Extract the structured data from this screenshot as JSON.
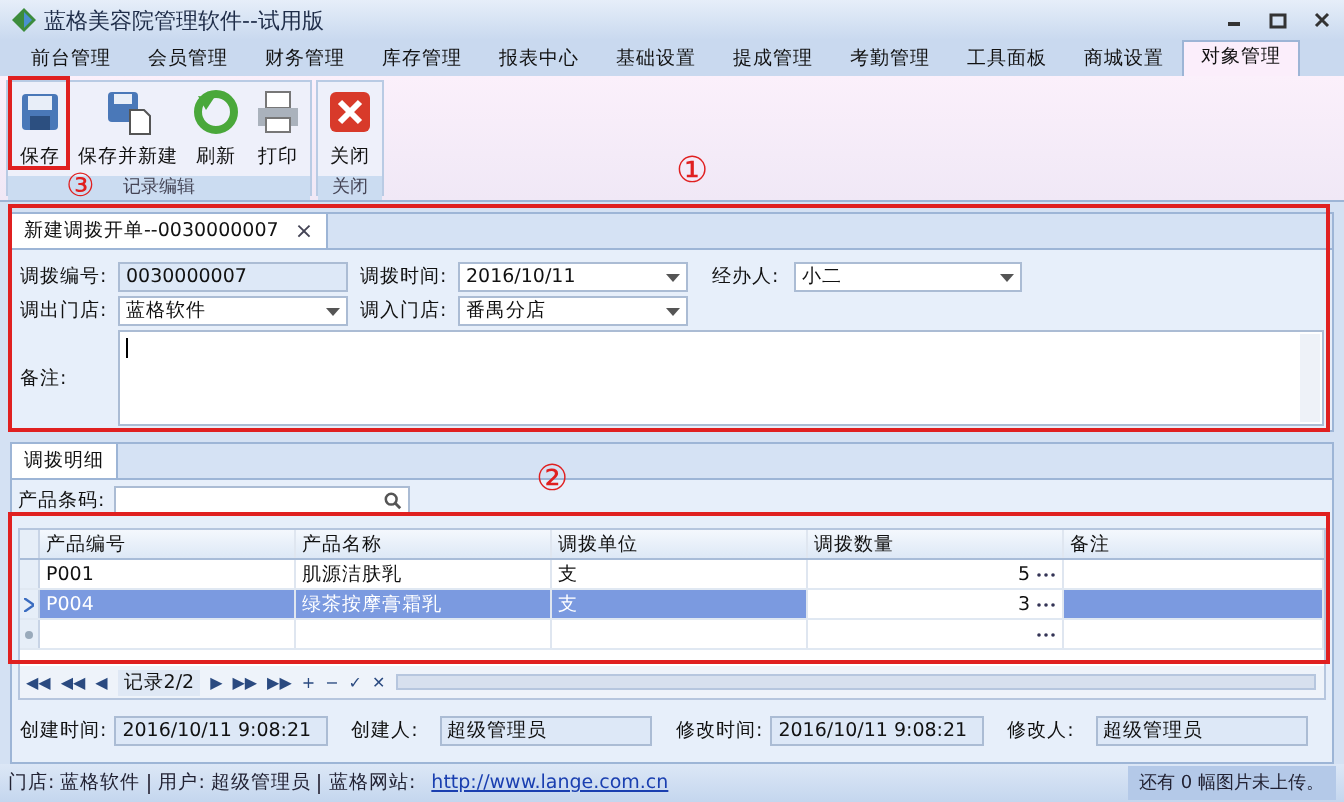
{
  "window": {
    "title": "蓝格美容院管理软件--试用版"
  },
  "menu_tabs": [
    {
      "label": "前台管理",
      "selected": false
    },
    {
      "label": "会员管理",
      "selected": false
    },
    {
      "label": "财务管理",
      "selected": false
    },
    {
      "label": "库存管理",
      "selected": false
    },
    {
      "label": "报表中心",
      "selected": false
    },
    {
      "label": "基础设置",
      "selected": false
    },
    {
      "label": "提成管理",
      "selected": false
    },
    {
      "label": "考勤管理",
      "selected": false
    },
    {
      "label": "工具面板",
      "selected": false
    },
    {
      "label": "商城设置",
      "selected": false
    },
    {
      "label": "对象管理",
      "selected": true
    }
  ],
  "ribbon_groups": [
    {
      "title": "记录编辑",
      "buttons": [
        {
          "label": "保存",
          "kind": "save"
        },
        {
          "label": "保存并新建",
          "kind": "savenew"
        },
        {
          "label": "刷新",
          "kind": "refresh"
        },
        {
          "label": "打印",
          "kind": "print"
        }
      ]
    },
    {
      "title": "关闭",
      "buttons": [
        {
          "label": "关闭",
          "kind": "close"
        }
      ]
    }
  ],
  "annotations": [
    "③",
    "①",
    "②"
  ],
  "document_tab": {
    "label": "新建调拨开单--0030000007",
    "close": "×"
  },
  "form": {
    "number_label": "调拨编号:",
    "number": "0030000007",
    "time_label": "调拨时间:",
    "time": "2016/10/11",
    "handler_label": "经办人:",
    "handler": "小二",
    "out_store_label": "调出门店:",
    "out_store": "蓝格软件",
    "in_store_label": "调入门店:",
    "in_store": "番禺分店",
    "remark_label": "备注:"
  },
  "detail_tab": {
    "label": "调拨明细"
  },
  "barcode": {
    "label": "产品条码:"
  },
  "grid": {
    "columns": [
      "产品编号",
      "产品名称",
      "调拨单位",
      "调拨数量",
      "备注"
    ],
    "rows": [
      {
        "cells": [
          "P001",
          "肌源洁肤乳",
          "支",
          "5",
          ""
        ],
        "selected": false
      },
      {
        "cells": [
          "P004",
          "绿茶按摩膏霜乳",
          "支",
          "3",
          ""
        ],
        "selected": true
      }
    ]
  },
  "navigator": {
    "record": "记录2/2",
    "first": "◀◀",
    "prev_page": "◀◀",
    "prev": "◀",
    "next": "▶",
    "next_page": "▶▶",
    "last": "▶▶",
    "add": "+",
    "remove": "−",
    "accept": "✓",
    "cancel": "✕"
  },
  "audit": [
    {
      "label": "创建时间:",
      "value": "2016/10/11 9:08:21"
    },
    {
      "label": "创建人:",
      "value": "超级管理员"
    },
    {
      "label": "修改时间:",
      "value": "2016/10/11 9:08:21"
    },
    {
      "label": "修改人:",
      "value": "超级管理员"
    }
  ],
  "status_bar": {
    "items": [
      "门店: 蓝格软件",
      "用户: 超级管理员",
      "蓝格网站:"
    ],
    "link": "http://www.lange.com.cn",
    "upload": "还有 0 幅图片未上传。"
  }
}
